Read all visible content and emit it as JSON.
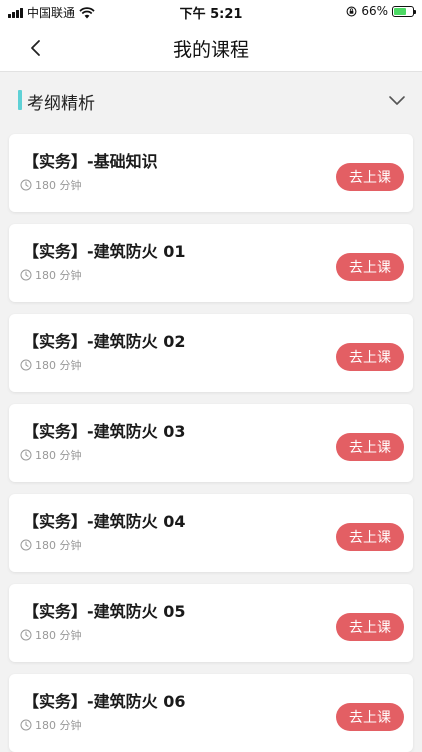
{
  "status_bar": {
    "carrier": "中国联通",
    "time": "下午 5:21",
    "battery": "66%"
  },
  "nav": {
    "title": "我的课程"
  },
  "section": {
    "title": "考纲精析"
  },
  "courses": [
    {
      "title": "【实务】-基础知识",
      "duration": "180 分钟",
      "action": "去上课"
    },
    {
      "title": "【实务】-建筑防火 01",
      "duration": "180 分钟",
      "action": "去上课"
    },
    {
      "title": "【实务】-建筑防火 02",
      "duration": "180 分钟",
      "action": "去上课"
    },
    {
      "title": "【实务】-建筑防火 03",
      "duration": "180 分钟",
      "action": "去上课"
    },
    {
      "title": "【实务】-建筑防火 04",
      "duration": "180 分钟",
      "action": "去上课"
    },
    {
      "title": "【实务】-建筑防火 05",
      "duration": "180 分钟",
      "action": "去上课"
    },
    {
      "title": "【实务】-建筑防火 06",
      "duration": "180 分钟",
      "action": "去上课"
    }
  ],
  "colors": {
    "accent": "#5fd1d6",
    "button": "#e35f64",
    "battery_fill": "#4cd964"
  }
}
